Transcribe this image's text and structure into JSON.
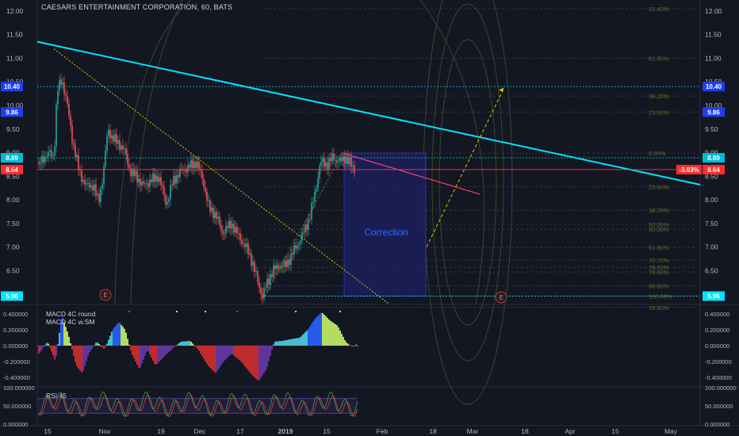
{
  "header": {
    "title": "CAESARS ENTERTAINMENT CORPORATION, 60, BATS"
  },
  "panes": {
    "macd_label_1": "MACD 4C round",
    "macd_label_2": "MACD 4C w.SM",
    "rsi_label": "RSI 45"
  },
  "colors": {
    "background": "#131722",
    "up": "#26a69a",
    "down": "#ef5350",
    "trendline": "#00e5ff",
    "price_line": "#ff3b3b",
    "fib": "#6b6b2a",
    "box": "#1b1f5a"
  },
  "chart_data": {
    "type": "candlestick",
    "price_axis": {
      "ticks": [
        "12.00",
        "11.50",
        "11.00",
        "10.50",
        "10.00",
        "9.50",
        "9.00",
        "8.50",
        "8.00",
        "7.50",
        "7.00",
        "6.50"
      ],
      "ylim": [
        5.8,
        12.1
      ]
    },
    "x_ticks": [
      "15",
      "Nov",
      "19",
      "Dec",
      "17",
      "2019",
      "15",
      "Feb",
      "18",
      "Mar",
      "18",
      "Apr",
      "15",
      "May"
    ],
    "badges": [
      {
        "label": "10.40",
        "value": 10.4,
        "color": "#1f3df2",
        "side": "both"
      },
      {
        "label": "9.86",
        "value": 9.86,
        "color": "#1f3df2",
        "side": "both"
      },
      {
        "label": "8.89",
        "value": 8.89,
        "color": "#00bcd4",
        "side": "both"
      },
      {
        "label": "8.64",
        "value": 8.64,
        "color": "#ff2d2d",
        "side": "both"
      },
      {
        "label": "-3.03%",
        "value": 8.64,
        "color": "#ff2d2d",
        "side": "right-inner"
      },
      {
        "label": "5.96",
        "value": 5.96,
        "color": "#00e5ff",
        "side": "both"
      }
    ],
    "fib_levels": [
      {
        "label": "31.40%",
        "value": 12.05
      },
      {
        "label": "61.80%",
        "value": 11.0
      },
      {
        "label": "38.20%",
        "value": 10.2
      },
      {
        "label": "23.60%",
        "value": 9.86
      },
      {
        "label": "0.00%",
        "value": 8.99
      },
      {
        "label": "23.60%",
        "value": 8.28
      },
      {
        "label": "38.20%",
        "value": 7.78
      },
      {
        "label": "50.00%",
        "value": 7.48
      },
      {
        "label": "50.00%",
        "value": 7.38
      },
      {
        "label": "61.80%",
        "value": 6.99
      },
      {
        "label": "70.70%",
        "value": 6.72
      },
      {
        "label": "78.60%",
        "value": 6.57
      },
      {
        "label": "78.60%",
        "value": 6.47
      },
      {
        "label": "88.60%",
        "value": 6.18
      },
      {
        "label": "100.00%",
        "value": 5.96
      },
      {
        "label": "78.60%",
        "value": 5.72
      }
    ],
    "annotation": "Correction",
    "earnings_markers": [
      "E",
      "E"
    ],
    "macd_axis": {
      "ticks": [
        "0.400000",
        "0.200000",
        "0.000000",
        "-0.200000",
        "-0.400000"
      ],
      "ylim": [
        -0.5,
        0.5
      ]
    },
    "rsi_axis": {
      "ticks": [
        "100.000000",
        "50.000000",
        "0.000000"
      ],
      "ylim": [
        0,
        100
      ]
    }
  }
}
